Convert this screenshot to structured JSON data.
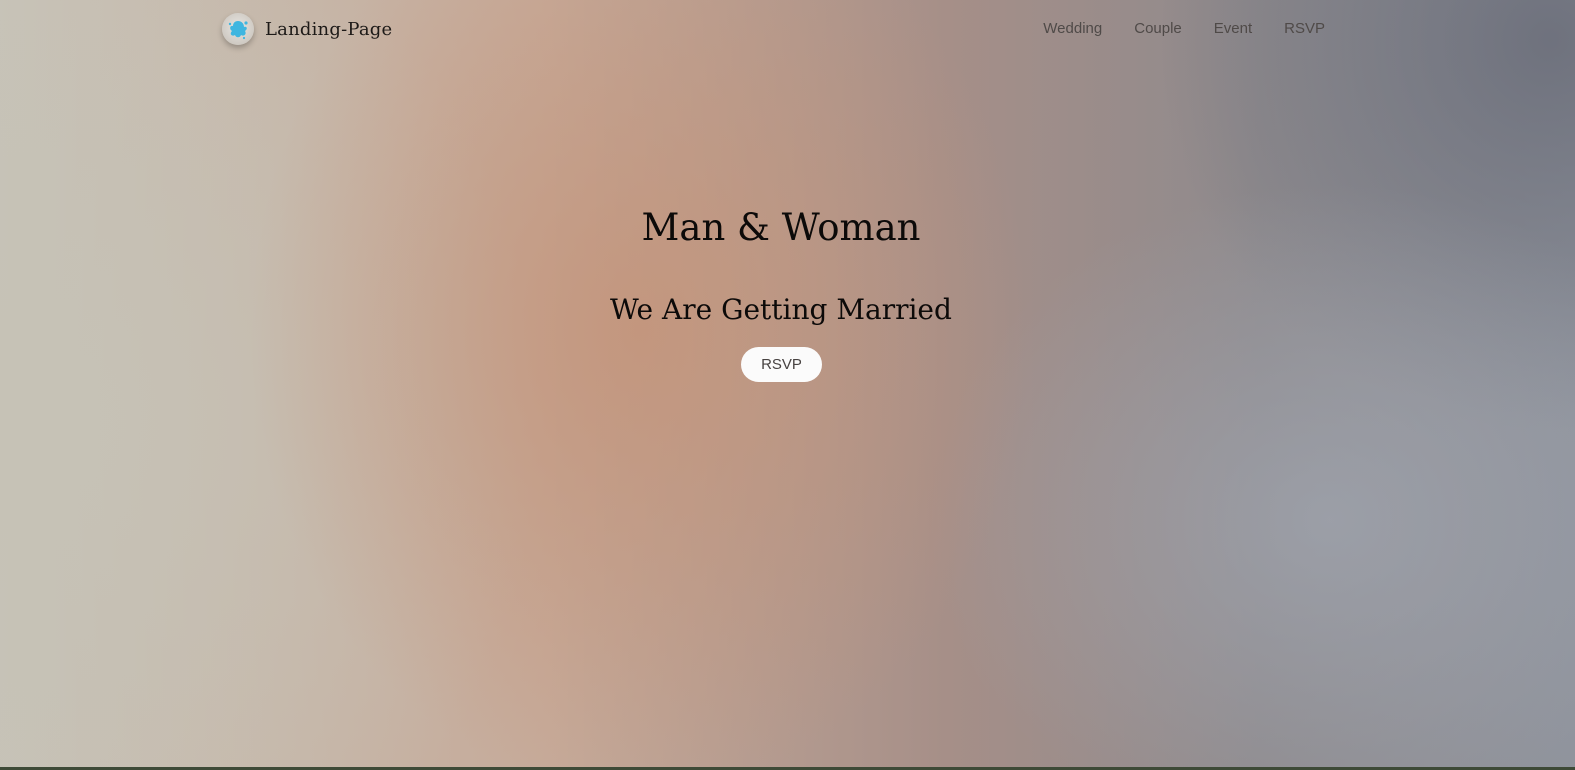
{
  "navbar": {
    "brand": {
      "name": "Landing-Page",
      "logo_icon": "paint-splash-icon",
      "logo_color": "#3fb6e0"
    },
    "links": [
      {
        "label": "Wedding"
      },
      {
        "label": "Couple"
      },
      {
        "label": "Event"
      },
      {
        "label": "RSVP"
      }
    ]
  },
  "hero": {
    "title": "Man & Woman",
    "subtitle": "We Are Getting Married",
    "button_label": "RSVP"
  },
  "colors": {
    "text": "#0c0a09",
    "nav_text": "#4f4a48",
    "button_bg": "#fbfbfb"
  }
}
